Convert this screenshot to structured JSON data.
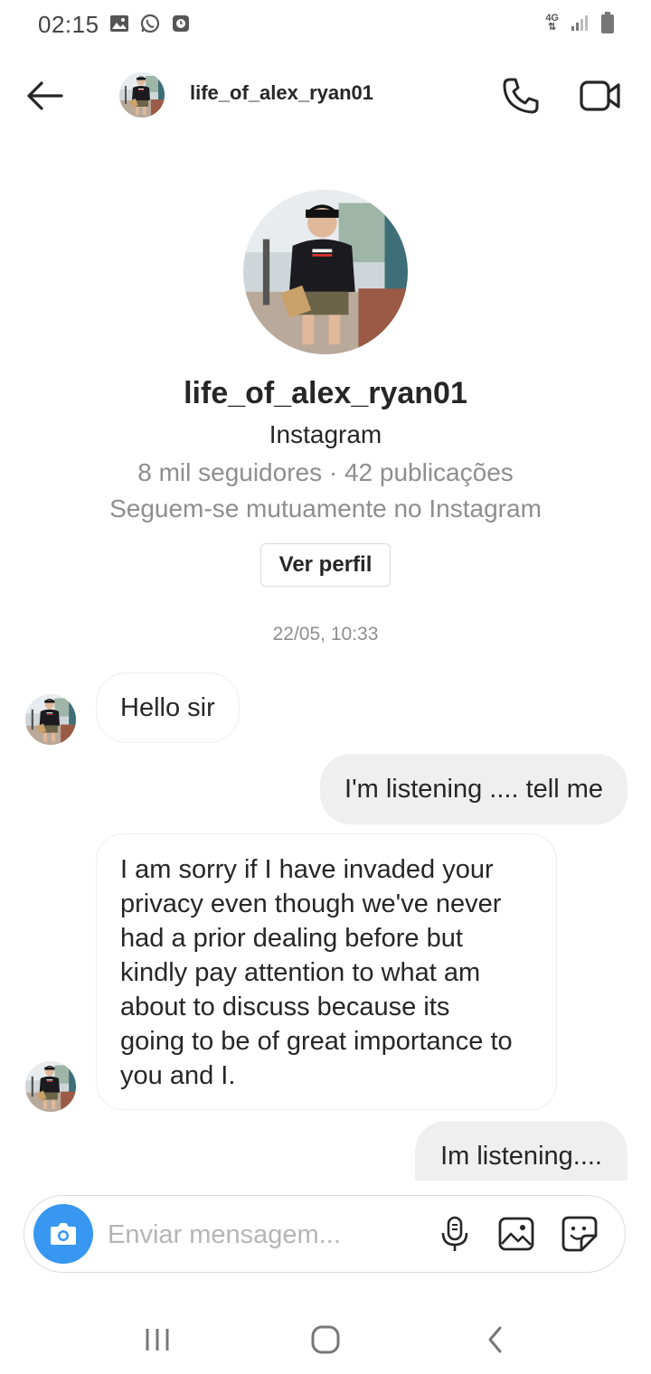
{
  "status_bar": {
    "time": "02:15",
    "network": "4G",
    "icons": [
      "image-icon",
      "whatsapp-icon",
      "clock-icon",
      "signal-icon",
      "battery-icon"
    ]
  },
  "header": {
    "username": "life_of_alex_ryan01",
    "icons": [
      "back-arrow-icon",
      "phone-icon",
      "video-camera-icon"
    ]
  },
  "profile": {
    "name": "life_of_alex_ryan01",
    "platform": "Instagram",
    "stats": "8 mil seguidores · 42 publicações",
    "mutual": "Seguem-se mutuamente no Instagram",
    "view_profile_label": "Ver perfil"
  },
  "timestamp": "22/05, 10:33",
  "messages": [
    {
      "direction": "incoming",
      "text": "Hello sir"
    },
    {
      "direction": "outgoing",
      "text": "I'm listening .... tell me"
    },
    {
      "direction": "incoming",
      "lines": [
        "I am sorry if I have invaded your",
        "privacy even though we've never",
        "had a prior dealing before but",
        "kindly pay attention to what am",
        "about to discuss because its",
        "going to be of great importance to",
        "you and I."
      ]
    },
    {
      "direction": "outgoing",
      "text": "Im listening...."
    }
  ],
  "composer": {
    "placeholder": "Enviar mensagem...",
    "icons": [
      "camera-icon",
      "microphone-icon",
      "gallery-icon",
      "sticker-icon"
    ]
  },
  "nav_bar": {
    "icons": [
      "recent-apps-icon",
      "home-icon",
      "back-icon"
    ]
  },
  "colors": {
    "accent_blue": "#3897f0",
    "outgoing_bubble": "#efefef",
    "secondary_text": "#8e8e8e",
    "border": "#dbdbdb"
  }
}
